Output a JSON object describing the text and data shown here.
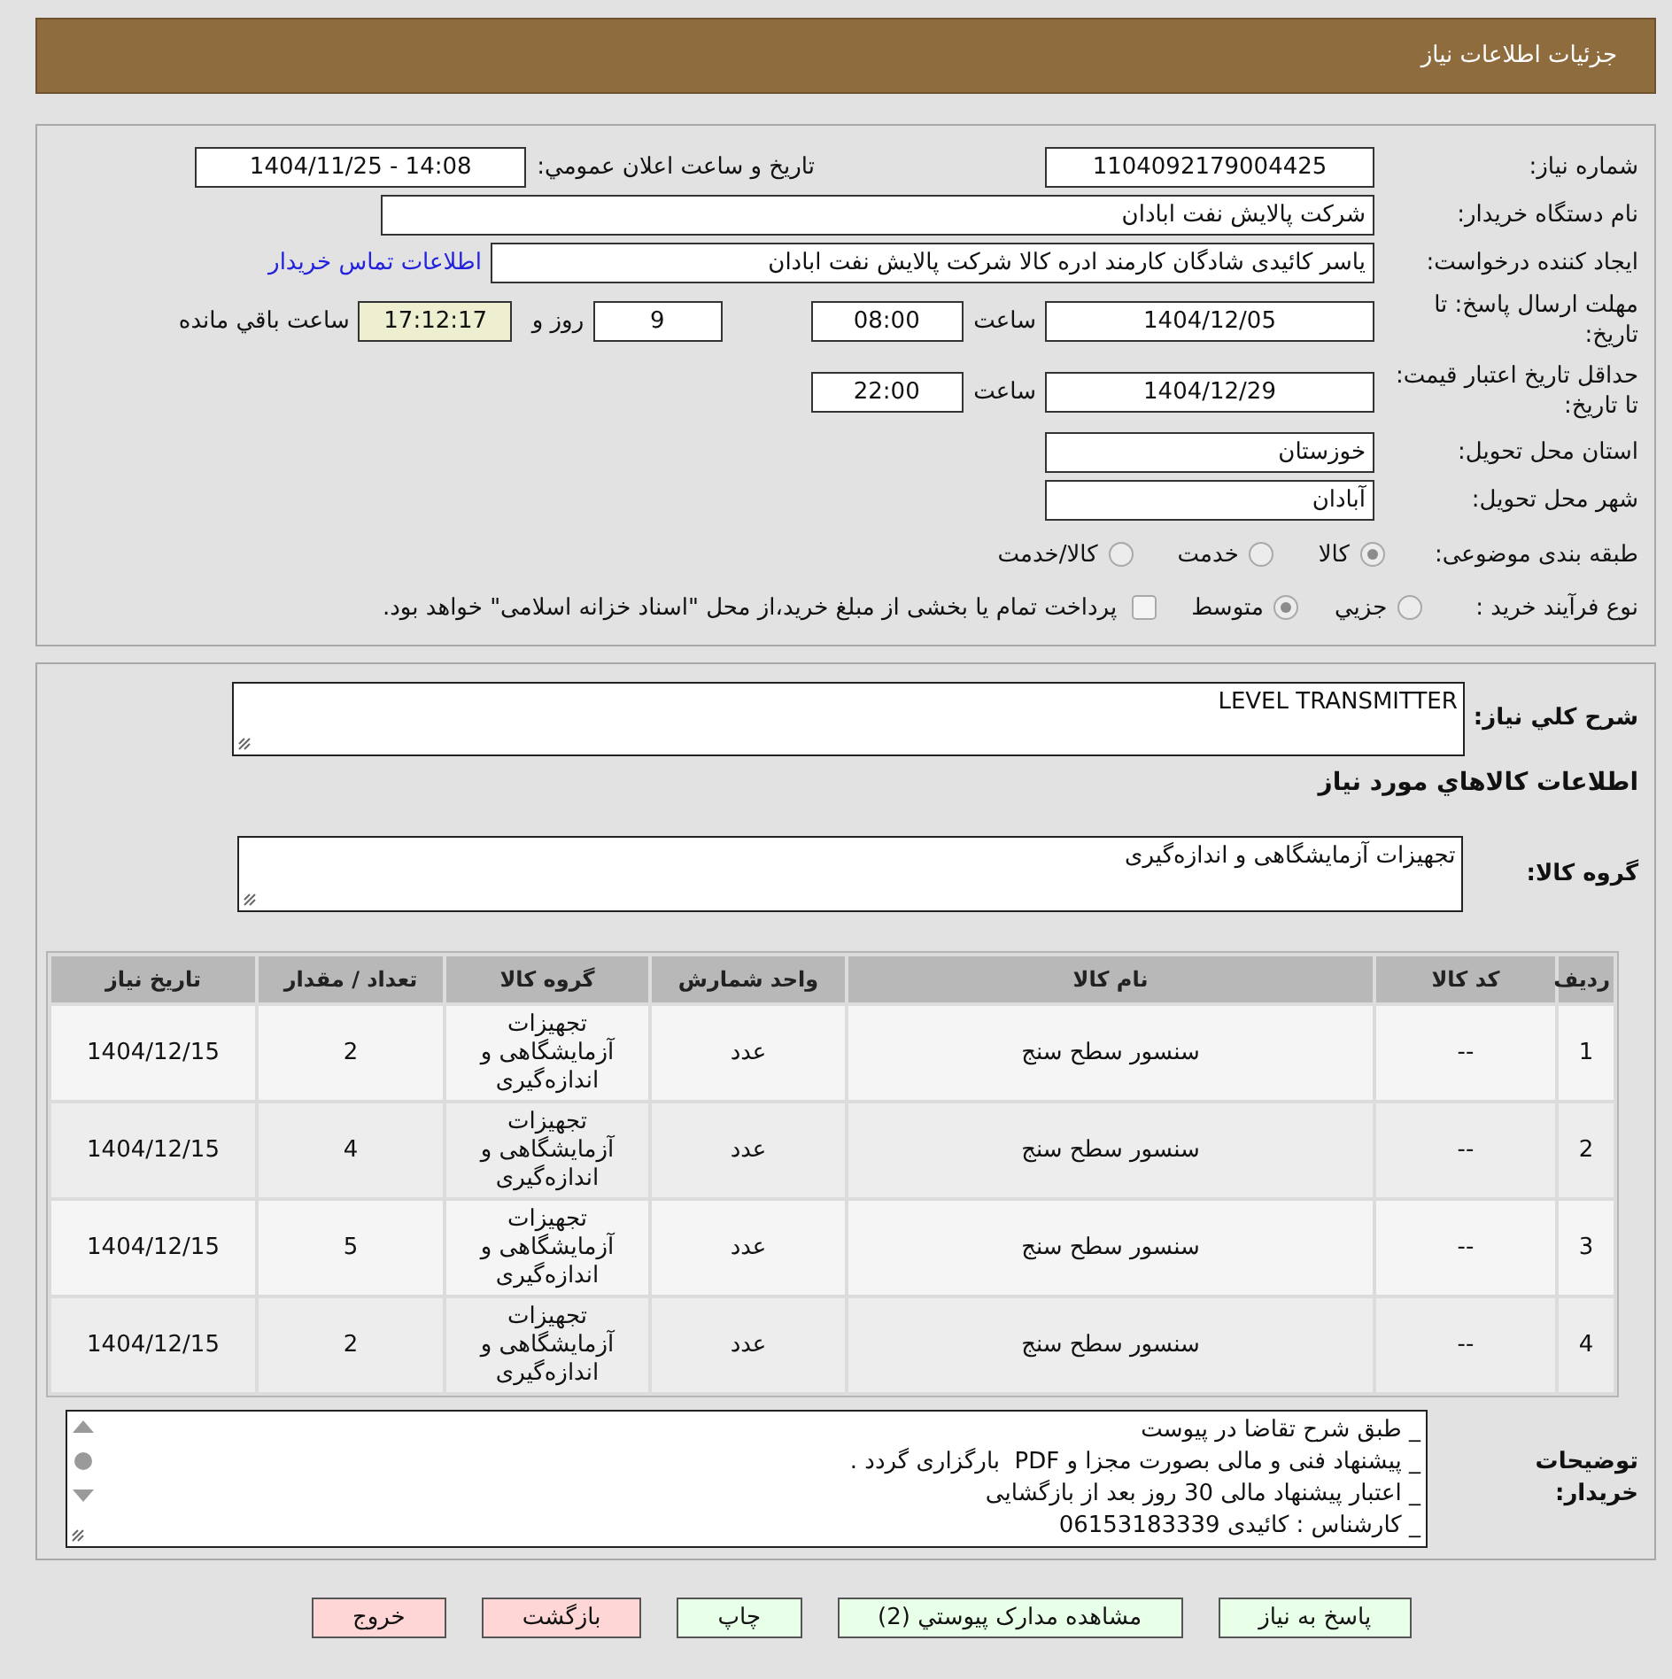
{
  "header": {
    "title": "جزئیات اطلاعات نیاز"
  },
  "details": {
    "need_number": {
      "label": "شماره نیاز:",
      "value": "1104092179004425"
    },
    "announcement": {
      "label": "تاریخ و ساعت اعلان عمومي:",
      "value": "1404/11/25 - 14:08"
    },
    "buyer_org": {
      "label": "نام دستگاه خریدار:",
      "value": "شرکت پالایش نفت ابادان"
    },
    "requester": {
      "label": "ایجاد کننده درخواست:",
      "value": "یاسر کائیدی شادگان کارمند ادره کالا شرکت پالایش نفت ابادان",
      "contact_link": "اطلاعات تماس خریدار"
    },
    "response_deadline": {
      "label": "مهلت ارسال پاسخ: تا تاریخ:",
      "date": "1404/12/05",
      "time_label": "ساعت",
      "time": "08:00",
      "days": "9",
      "days_label": "روز و",
      "remaining": "17:12:17",
      "remaining_label": "ساعت باقي مانده"
    },
    "price_validity": {
      "label": "حداقل تاریخ اعتبار قیمت: تا تاریخ:",
      "date": "1404/12/29",
      "time_label": "ساعت",
      "time": "22:00"
    },
    "province": {
      "label": "استان محل تحویل:",
      "value": "خوزستان"
    },
    "city": {
      "label": "شهر محل تحویل:",
      "value": "آبادان"
    },
    "category": {
      "label": "طبقه بندی موضوعی:",
      "options": [
        {
          "label": "کالا",
          "selected": true
        },
        {
          "label": "خدمت",
          "selected": false
        },
        {
          "label": "کالا/خدمت",
          "selected": false
        }
      ]
    },
    "purchase_type": {
      "label": "نوع فرآیند خرید :",
      "options": [
        {
          "label": "جزيي",
          "selected": false
        },
        {
          "label": "متوسط",
          "selected": true
        }
      ],
      "treasury_payment": {
        "label": "پرداخت تمام یا بخشی از مبلغ خرید،از محل \"اسناد خزانه اسلامی\" خواهد بود.",
        "checked": false
      }
    }
  },
  "needs": {
    "summary": {
      "label": "شرح كلي نیاز:",
      "value": "LEVEL TRANSMITTER"
    },
    "items_title": "اطلاعات كالاهاي مورد نیاز",
    "goods_group": {
      "label": "گروه کالا:",
      "value": "تجهیزات آزمایشگاهی و اندازه‌گیری"
    },
    "table": {
      "columns": [
        "ردیف",
        "کد کالا",
        "نام کالا",
        "واحد شمارش",
        "گروه کالا",
        "تعداد / مقدار",
        "تاریخ نیاز"
      ],
      "rows": [
        [
          "1",
          "--",
          "سنسور سطح سنج",
          "عدد",
          "تجهیزات آزمایشگاهی و اندازه‌گیری",
          "2",
          "1404/12/15"
        ],
        [
          "2",
          "--",
          "سنسور سطح سنج",
          "عدد",
          "تجهیزات آزمایشگاهی و اندازه‌گیری",
          "4",
          "1404/12/15"
        ],
        [
          "3",
          "--",
          "سنسور سطح سنج",
          "عدد",
          "تجهیزات آزمایشگاهی و اندازه‌گیری",
          "5",
          "1404/12/15"
        ],
        [
          "4",
          "--",
          "سنسور سطح سنج",
          "عدد",
          "تجهیزات آزمایشگاهی و اندازه‌گیری",
          "2",
          "1404/12/15"
        ]
      ]
    },
    "buyer_notes": {
      "label": "توضیحات خریدار:",
      "value": "_ طبق شرح تقاضا در پیوست\n_ پیشنهاد فنی و مالی بصورت مجزا و PDF  بارگزاری گردد .\n_ اعتبار پیشنهاد مالی 30 روز بعد از بازگشایی\n_ کارشناس : کائیدی 06153183339"
    }
  },
  "buttons": [
    {
      "label": "پاسخ به نیاز",
      "kind": "action"
    },
    {
      "label": "مشاهده مدارک پیوستي (2)",
      "kind": "action"
    },
    {
      "label": "چاپ",
      "kind": "action"
    },
    {
      "label": "بازگشت",
      "kind": "cancel"
    },
    {
      "label": "خروج",
      "kind": "cancel"
    }
  ]
}
